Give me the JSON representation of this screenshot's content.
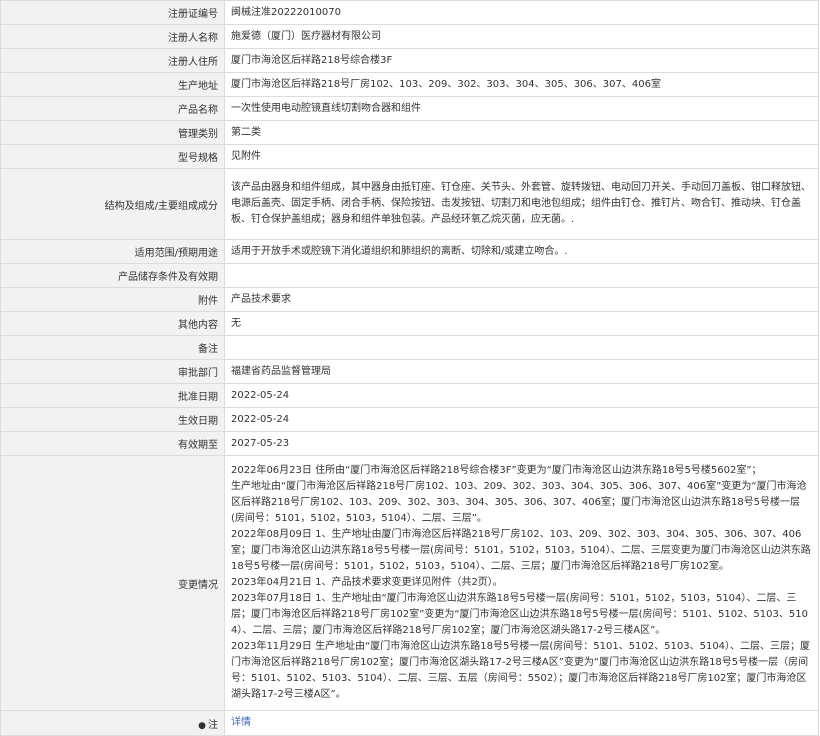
{
  "rows": [
    {
      "label": "注册证编号",
      "value": "闽械注准20222010070"
    },
    {
      "label": "注册人名称",
      "value": "施爱德（厦门）医疗器材有限公司"
    },
    {
      "label": "注册人住所",
      "value": "厦门市海沧区后祥路218号综合楼3F"
    },
    {
      "label": "生产地址",
      "value": "厦门市海沧区后祥路218号厂房102、103、209、302、303、304、305、306、307、406室"
    },
    {
      "label": "产品名称",
      "value": "一次性使用电动腔镜直线切割吻合器和组件"
    },
    {
      "label": "管理类别",
      "value": "第二类"
    },
    {
      "label": "型号规格",
      "value": "见附件"
    },
    {
      "label": "结构及组成/主要组成成分",
      "value": "该产品由器身和组件组成，其中器身由抵钉座、钉仓座、关节头、外套管、旋转拨钮、电动回刀开关、手动回刀盖板、钳口释放钮、电源后盖壳、固定手柄、闭合手柄、保险按钮、击发按钮、切割刀和电池包组成；组件由钉仓、推钉片、吻合钉、推动块、钉仓盖板、钉仓保护盖组成；器身和组件单独包装。产品经环氧乙烷灭菌，应无菌。."
    },
    {
      "label": "适用范围/预期用途",
      "value": "适用于开放手术或腔镜下消化道组织和肺组织的离断、切除和/或建立吻合。."
    },
    {
      "label": "产品储存条件及有效期",
      "value": ""
    },
    {
      "label": "附件",
      "value": "产品技术要求"
    },
    {
      "label": "其他内容",
      "value": "无"
    },
    {
      "label": "备注",
      "value": ""
    },
    {
      "label": "审批部门",
      "value": "福建省药品监督管理局"
    },
    {
      "label": "批准日期",
      "value": "2022-05-24"
    },
    {
      "label": "生效日期",
      "value": "2022-05-24"
    },
    {
      "label": "有效期至",
      "value": "2027-05-23"
    }
  ],
  "changes": {
    "label": "变更情况",
    "entries": [
      "2022年06月23日 住所由“厦门市海沧区后祥路218号综合楼3F”变更为“厦门市海沧区山边洪东路18号5号楼5602室”；",
      "生产地址由“厦门市海沧区后祥路218号厂房102、103、209、302、303、304、305、306、307、406室”变更为“厦门市海沧区后祥路218号厂房102、103、209、302、303、304、305、306、307、406室；厦门市海沧区山边洪东路18号5号楼一层(房间号：5101，5102，5103，5104）、二层、三层”。",
      "2022年08月09日 1、生产地址由厦门市海沧区后祥路218号厂房102、103、209、302、303、304、305、306、307、406室；厦门市海沧区山边洪东路18号5号楼一层(房间号：5101，5102，5103，5104）、二层、三层变更为厦门市海沧区山边洪东路18号5号楼一层(房间号：5101，5102，5103，5104）、二层、三层；厦门市海沧区后祥路218号厂房102室。",
      "2023年04月21日 1、产品技术要求变更详见附件（共2页）。",
      "2023年07月18日 1、生产地址由“厦门市海沧区山边洪东路18号5号楼一层(房间号：5101，5102，5103，5104）、二层、三层；厦门市海沧区后祥路218号厂房102室”变更为“厦门市海沧区山边洪东路18号5号楼一层(房间号：5101、5102、5103、5104）、二层、三层；厦门市海沧区后祥路218号厂房102室；厦门市海沧区湖头路17-2号三楼A区”。",
      "2023年11月29日 生产地址由“厦门市海沧区山边洪东路18号5号楼一层(房间号：5101、5102、5103、5104）、二层、三层；厦门市海沧区后祥路218号厂房102室；厦门市海沧区湖头路17-2号三楼A区”变更为“厦门市海沧区山边洪东路18号5号楼一层（房间号：5101、5102、5103、5104）、二层、三层、五层（房间号：5502）；厦门市海沧区后祥路218号厂房102室；厦门市海沧区湖头路17-2号三楼A区”。"
    ]
  },
  "note_row": {
    "icon": "●",
    "label": "注",
    "link": "详情"
  }
}
